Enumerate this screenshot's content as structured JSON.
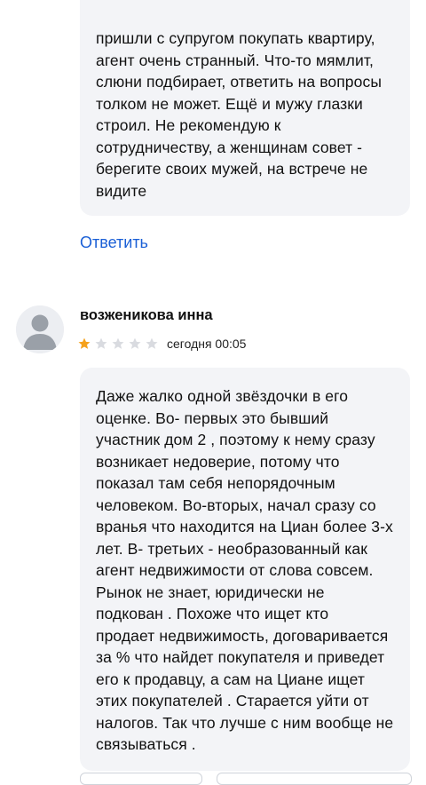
{
  "previous_review": {
    "text": "пришли с супругом покупать квартиру,\nагент очень странный. Что-то мямлит,\nслюни подбирает, ответить на вопросы\nтолком не может. Ещё и мужу глазки\nстроил. Не рекомендую к\nсотрудничеству, а женщинам совет -\nберегите своих мужей, на встрече не\nвидите",
    "reply_label": "Ответить"
  },
  "review": {
    "author": "возженикова инна",
    "avatar_icon": "user-silhouette-icon",
    "rating": 1,
    "rating_max": 5,
    "star_color_filled": "#f5a11c",
    "star_color_empty": "#d9dbe0",
    "date": "сегодня 00:05",
    "text": "Даже жалко одной звёздочки в его\nоценке. Во- первых это бывший\nучастник дом 2 , поэтому к нему сразу\nвозникает недоверие, потому что\nпоказал там себя непорядочным\nчеловеком. Во-вторых, начал сразу со\nвранья что находится на Циан более 3-х\nлет. В- третьих - необразованный как\nагент недвижимости от слова совсем.\nРынок не знает, юридически не\nподкован . Похоже что ищет кто\nпродает недвижимость, договаривается\nза % что найдет покупателя и приведет\nего к продавцу, а сам на Циане ищет\nэтих покупателей . Старается уйти от\nналогов. Так что лучше с ним вообще не\nсвязываться ."
  },
  "colors": {
    "bubble_bg": "#f3f4f7",
    "link": "#1a5fd6",
    "text": "#111111"
  }
}
